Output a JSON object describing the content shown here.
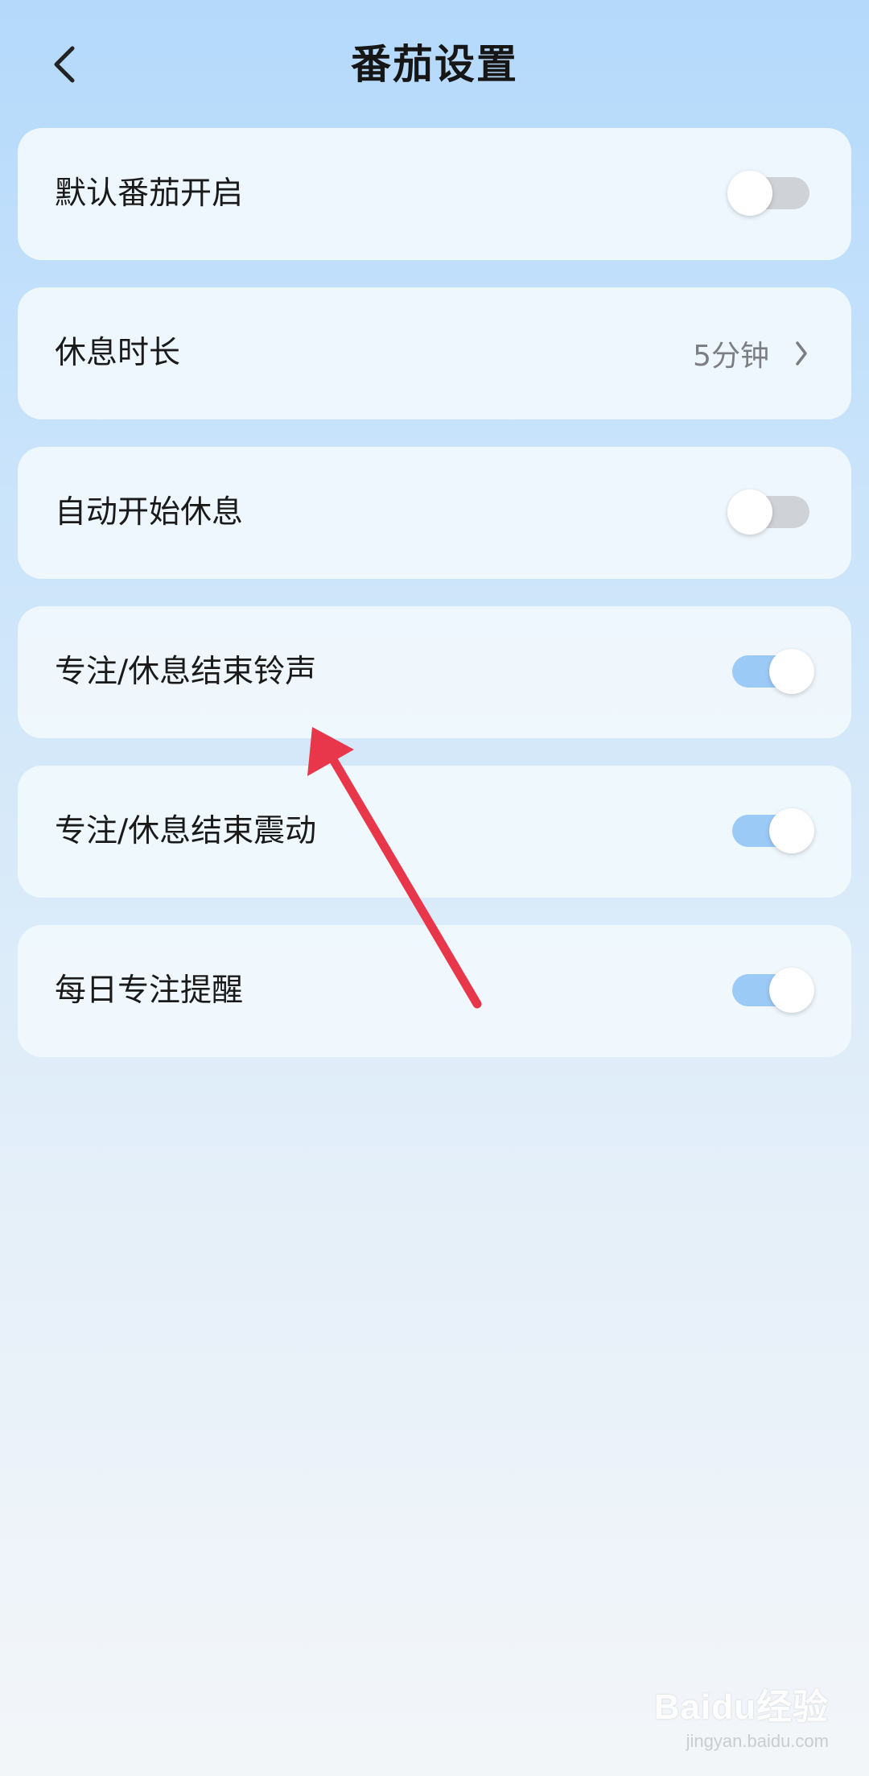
{
  "header": {
    "title": "番茄设置",
    "back_icon": "chevron-left-icon"
  },
  "settings": [
    {
      "label": "默认番茄开启",
      "control": "toggle",
      "on": false
    },
    {
      "label": "休息时长",
      "control": "value",
      "value": "5分钟",
      "icon": "chevron-right-icon"
    },
    {
      "label": "自动开始休息",
      "control": "toggle",
      "on": false
    },
    {
      "label": "专注/休息结束铃声",
      "control": "toggle",
      "on": true
    },
    {
      "label": "专注/休息结束震动",
      "control": "toggle",
      "on": true
    },
    {
      "label": "每日专注提醒",
      "control": "toggle",
      "on": true
    }
  ],
  "colors": {
    "toggle_on": "#9ccaf7",
    "toggle_off": "#cfd2d6",
    "annotation_arrow": "#e8374a"
  },
  "watermark": {
    "logo": "Baidu经验",
    "url": "jingyan.baidu.com"
  }
}
